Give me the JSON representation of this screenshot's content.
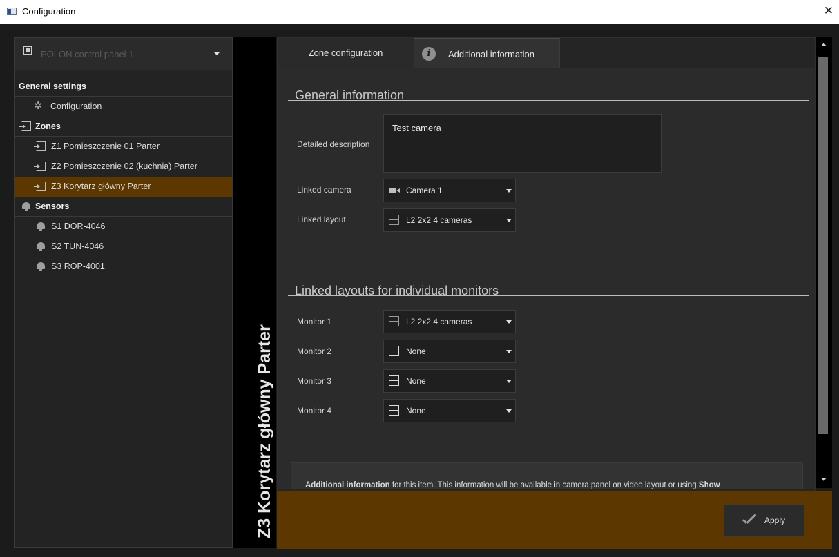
{
  "window": {
    "title": "Configuration",
    "close_glyph": "✕"
  },
  "left_panel": {
    "control_panel": "POLON control panel 1",
    "tree": {
      "general_settings": "General settings",
      "configuration": "Configuration",
      "zones": "Zones",
      "zone_items": [
        "Z1 Pomieszczenie 01 Parter",
        "Z2 Pomieszczenie 02 (kuchnia) Parter",
        "Z3 Korytarz główny Parter"
      ],
      "sensors": "Sensors",
      "sensor_items": [
        "S1 DOR-4046",
        "S2 TUN-4046",
        "S3 ROP-4001"
      ]
    }
  },
  "vertical_title": "Z3 Korytarz główny Parter",
  "tabs": {
    "zone_configuration": "Zone configuration",
    "additional_information": "Additional information",
    "info_glyph": "i"
  },
  "general_info": {
    "section_title": "General information",
    "detailed_description_label": "Detailed description",
    "detailed_description_value": "Test camera",
    "linked_camera_label": "Linked camera",
    "linked_camera_value": "Camera 1",
    "linked_layout_label": "Linked layout",
    "linked_layout_value": "L2 2x2 4 cameras"
  },
  "monitors": {
    "section_title": "Linked layouts for individual monitors",
    "items": [
      {
        "label": "Monitor 1",
        "value": "L2 2x2 4 cameras"
      },
      {
        "label": "Monitor 2",
        "value": "None"
      },
      {
        "label": "Monitor 3",
        "value": "None"
      },
      {
        "label": "Monitor 4",
        "value": "None"
      }
    ]
  },
  "info_box": {
    "bold_start": "Additional information",
    "text_middle": " for this item. This information will be available in camera panel on video layout or using ",
    "bold_end": "Show"
  },
  "footer": {
    "apply_label": "Apply"
  },
  "colors": {
    "accent": "#5c3700",
    "background": "#1b1b1b",
    "panel": "#2b2b2b"
  }
}
